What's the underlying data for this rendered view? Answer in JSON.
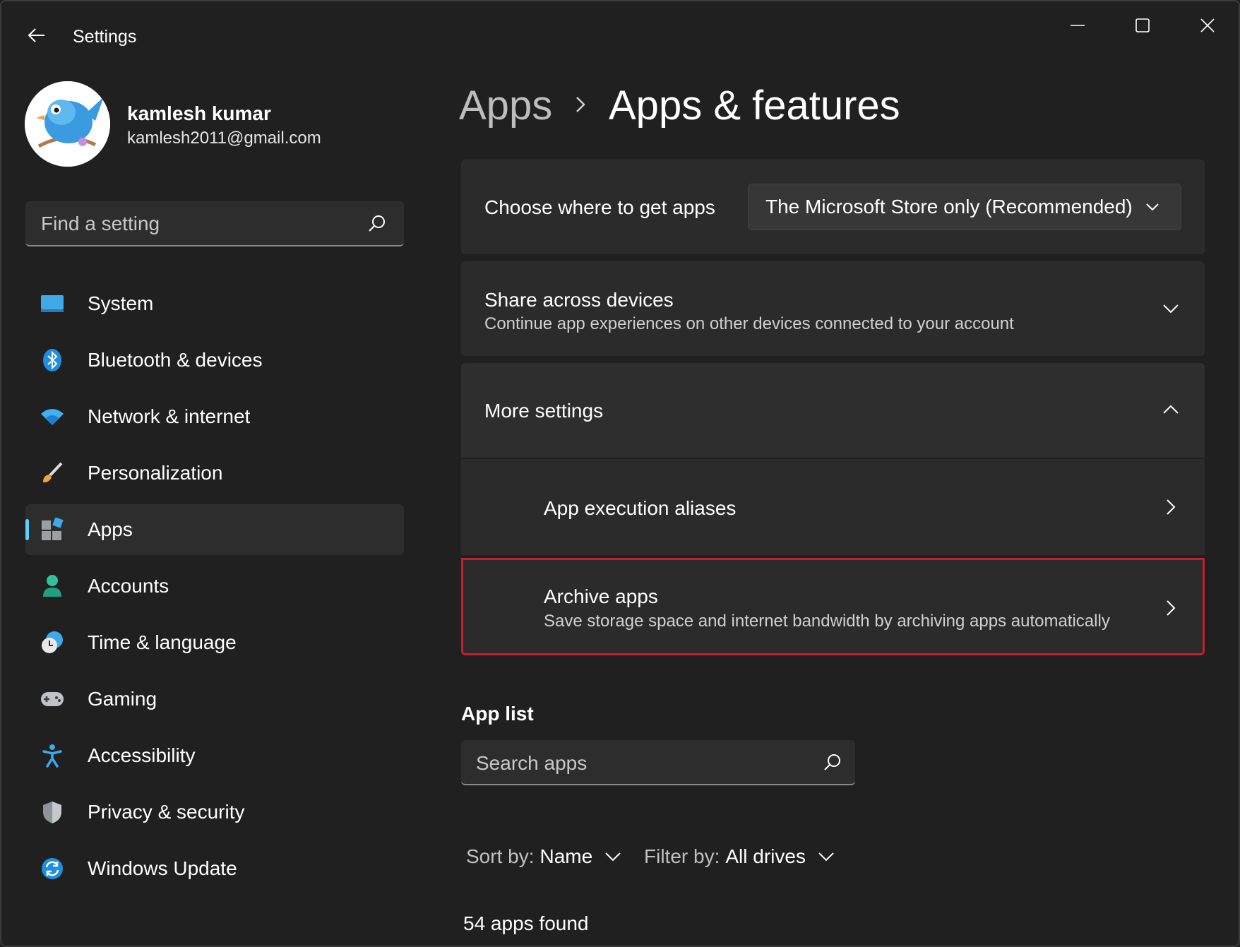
{
  "window": {
    "title": "Settings",
    "controls": [
      "minimize-icon",
      "maximize-icon",
      "close-icon"
    ]
  },
  "user": {
    "name": "kamlesh kumar",
    "email": "kamlesh2011@gmail.com"
  },
  "search": {
    "placeholder": "Find a setting"
  },
  "nav": {
    "items": [
      {
        "label": "System",
        "icon": "system-icon"
      },
      {
        "label": "Bluetooth & devices",
        "icon": "bluetooth-icon"
      },
      {
        "label": "Network & internet",
        "icon": "wifi-icon"
      },
      {
        "label": "Personalization",
        "icon": "brush-icon"
      },
      {
        "label": "Apps",
        "icon": "apps-icon",
        "selected": true
      },
      {
        "label": "Accounts",
        "icon": "account-icon"
      },
      {
        "label": "Time & language",
        "icon": "time-language-icon"
      },
      {
        "label": "Gaming",
        "icon": "gamepad-icon"
      },
      {
        "label": "Accessibility",
        "icon": "accessibility-icon"
      },
      {
        "label": "Privacy & security",
        "icon": "shield-icon"
      },
      {
        "label": "Windows Update",
        "icon": "update-icon"
      }
    ]
  },
  "breadcrumb": {
    "parent": "Apps",
    "current": "Apps & features"
  },
  "choose_apps": {
    "label": "Choose where to get apps",
    "value": "The Microsoft Store only (Recommended)"
  },
  "share": {
    "title": "Share across devices",
    "subtitle": "Continue app experiences on other devices connected to your account"
  },
  "more_settings": {
    "title": "More settings",
    "items": [
      {
        "title": "App execution aliases"
      },
      {
        "title": "Archive apps",
        "subtitle": "Save storage space and internet bandwidth by archiving apps automatically"
      }
    ]
  },
  "app_list": {
    "title": "App list",
    "search_placeholder": "Search apps",
    "sort_label": "Sort by:",
    "sort_value": "Name",
    "filter_label": "Filter by:",
    "filter_value": "All drives",
    "count_text": "54 apps found"
  },
  "colors": {
    "accent": "#60cdff",
    "highlight_border": "#c41e2a",
    "background": "#202020",
    "card": "#2b2b2b"
  }
}
